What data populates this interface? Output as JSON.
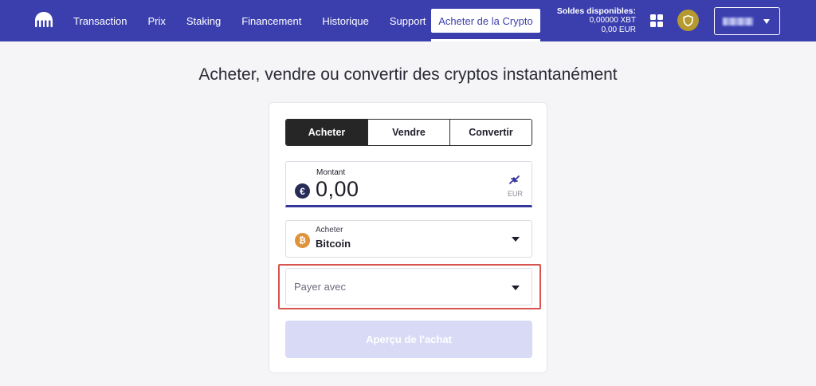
{
  "nav": {
    "links": [
      "Transaction",
      "Prix",
      "Staking",
      "Financement",
      "Historique",
      "Support"
    ],
    "buy_crypto": "Acheter de la Crypto",
    "balances": {
      "title": "Soldes disponibles:",
      "xbt": "0,00000 XBT",
      "eur": "0,00 EUR"
    },
    "colors": {
      "brand": "#3b3fae",
      "badge": "#b59a2f"
    }
  },
  "page": {
    "title": "Acheter, vendre ou convertir des cryptos instantanément"
  },
  "trade": {
    "tabs": [
      "Acheter",
      "Vendre",
      "Convertir"
    ],
    "active_tab": "Acheter",
    "amount": {
      "label": "Montant",
      "currency_symbol": "€",
      "value": "0,00",
      "unit": "EUR"
    },
    "asset": {
      "label": "Acheter",
      "value": "Bitcoin",
      "icon_symbol": "₿"
    },
    "pay_with": {
      "placeholder": "Payer avec"
    },
    "preview_button": "Aperçu de l'achat"
  }
}
